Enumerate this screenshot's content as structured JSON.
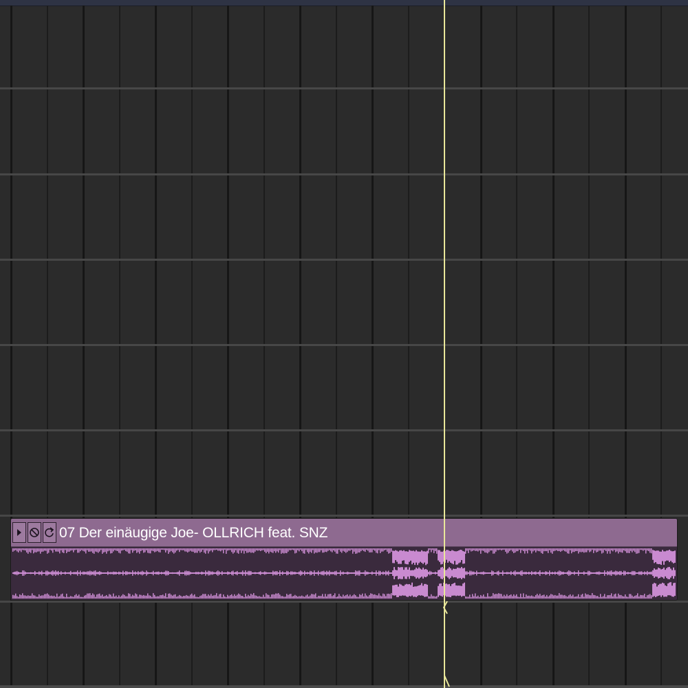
{
  "region": {
    "title": "07 Der einäugige Joe- OLLRICH feat. SNZ",
    "color": "#8e6a90",
    "wave_color": "#c98ad0",
    "buttons": [
      {
        "name": "play-icon"
      },
      {
        "name": "mute-icon"
      },
      {
        "name": "loop-icon"
      }
    ]
  },
  "playhead": {
    "color": "#e9e79a"
  }
}
